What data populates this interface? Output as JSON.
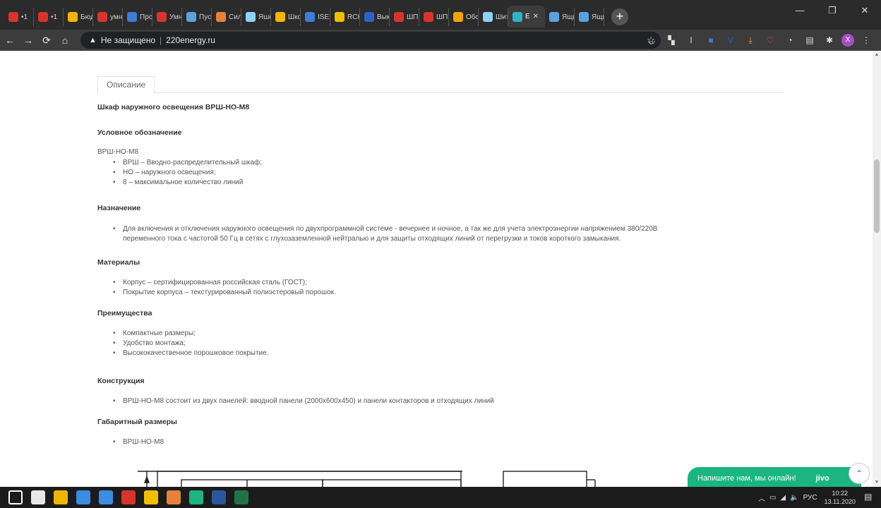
{
  "browser": {
    "tabs": [
      {
        "label": "•1",
        "color": "#d9342b"
      },
      {
        "label": "•1",
        "color": "#d9342b"
      },
      {
        "label": "Бюд",
        "color": "#f5b400"
      },
      {
        "label": "умн",
        "color": "#d9342b"
      },
      {
        "label": "Про",
        "color": "#3b7dd8"
      },
      {
        "label": "Умн",
        "color": "#d9342b"
      },
      {
        "label": "Пус",
        "color": "#57a3e0"
      },
      {
        "label": "Сил",
        "color": "#e8823a"
      },
      {
        "label": "Яше",
        "color": "#8ad3f5"
      },
      {
        "label": "Шко",
        "color": "#f5b400"
      },
      {
        "label": "ISEF",
        "color": "#3b7dd8"
      },
      {
        "label": "RCH",
        "color": "#f0c000"
      },
      {
        "label": "Вык",
        "color": "#2a62c9"
      },
      {
        "label": "ШП",
        "color": "#d9342b"
      },
      {
        "label": "ШП",
        "color": "#d9342b"
      },
      {
        "label": "Обс",
        "color": "#f5a300"
      },
      {
        "label": "Шит",
        "color": "#8ad3f5"
      }
    ],
    "active_tab": {
      "label": "Е",
      "color": "#2fb3c9"
    },
    "extra_tabs": [
      {
        "label": "Ящи",
        "color": "#57a3e0"
      },
      {
        "label": "Ящи",
        "color": "#57a3e0"
      }
    ],
    "address": {
      "security": "Не защищено",
      "url": "220energy.ru"
    },
    "profile_initial": "X"
  },
  "page": {
    "tab_label": "Описание",
    "title": "Шкаф наружного освещения ВРШ-НО-М8",
    "designation_heading": "Условное обозначение",
    "designation_code": "ВРШ-НО-М8",
    "designation_items": [
      "ВРШ – Вводно-распределительный шкаф;",
      "НО – наружного освещения;",
      "8 – максимальное количество линий"
    ],
    "purpose_heading": "Назначение",
    "purpose_text_1": "Для включения и отключения наружного освещения по двухпрограммной системе - вечернее и ночное, а так же для учета электроэнергии напряжением 380/220В",
    "purpose_text_2": "переменного тока с частотой 50 Гц в сетях с глухозаземленной нейтралью и для защиты отходящих линий от перегрузки и токов короткого замыкания.",
    "materials_heading": "Материалы",
    "materials_items": [
      "Корпус – сертифицированная российская сталь (ГОСТ);",
      "Покрытие корпуса – текстурированный полиэстеровый порошок."
    ],
    "advantages_heading": "Преимущества",
    "advantages_items": [
      "Компактные размеры;",
      "Удобство монтажа;",
      "Высококачественное порошковое покрытие."
    ],
    "construction_heading": "Конструкция",
    "construction_items": [
      "ВРШ-НО-М8 состоит из двух панелей: вводной панели (2000x600x450) и панели контакторов и отходящих линий"
    ],
    "dimensions_heading": "Габаритный размеры",
    "dimensions_items": [
      "ВРШ-НО-М8"
    ]
  },
  "jivo": {
    "text": "Напишите нам, мы онлайн!",
    "brand": "jivo"
  },
  "taskbar": {
    "lang": "РУС",
    "time": "10:22",
    "date": "13.11.2020",
    "apps": [
      "#ffffff",
      "#e8e8e8",
      "#f0b400",
      "#3a8de0",
      "#3a8de0",
      "#d9342b",
      "#f0c000",
      "#e8823a",
      "#1bb581",
      "#2b579a",
      "#217346"
    ]
  }
}
